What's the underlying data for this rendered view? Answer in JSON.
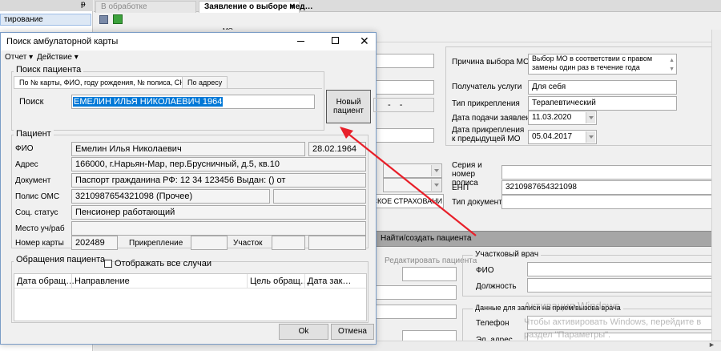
{
  "left_panel": {
    "pin": "ᵽ",
    "item": "тирование"
  },
  "doc_tabs": [
    {
      "label": "В обработке"
    },
    {
      "label": "Заявление о выборе мед…",
      "close": "✕"
    }
  ],
  "main_right": {
    "reason_label": "Причина выбора МО",
    "reason_value": "Выбор МО в соответствии с правом замены один раз в течение года",
    "recipient_label": "Получатель услуги",
    "recipient_value": "Для себя",
    "attach_type_label": "Тип прикрепления",
    "attach_type_value": "Терапевтический",
    "apply_date_label": "Дата подачи заявления",
    "apply_date_value": "11.03.2020",
    "prev_date_label": "Дата прикрепления к предыдущей МО",
    "prev_date_value": "05.04.2017",
    "series_label": "Серия и номер полиса",
    "enp_label": "ЕНП",
    "enp_value": "3210987654321098",
    "doc_type_label": "Тип документа",
    "insurer_value": "НСКОЕ СТРАХОВАНИ",
    "find_create_button": "Найти/создать пациента",
    "edit_patient_button": "Редактировать пациента",
    "doctor_group": "Участковый врач",
    "doctor_fio_label": "ФИО",
    "doctor_position_label": "Должность",
    "visit_group": "Данные для записи на прием/вызова врача",
    "phone_label": "Телефон",
    "email_label": "Эл. адрес",
    "watermark_title": "Активация Windows",
    "watermark_text": "Чтобы активировать Windows, перейдите в раздел \"Параметры\".",
    "mo_label": "МО"
  },
  "dialog": {
    "title": "Поиск амбулаторной карты",
    "menu": [
      {
        "label": "Отчет"
      },
      {
        "label": "Действие"
      }
    ],
    "search_group": "Поиск пациента",
    "search_tabs": [
      {
        "label": "По № карты, ФИО, году рождения, № полиса, СНИЛС"
      },
      {
        "label": "По адресу"
      }
    ],
    "search_label": "Поиск",
    "search_value": "ЕМЕЛИН ИЛЬЯ НИКОЛАЕВИЧ 1964",
    "new_patient_button": "Новый пациент",
    "patient_group": "Пациент",
    "fio_label": "ФИО",
    "fio_value": "Емелин Илья Николаевич",
    "birth_value": "28.02.1964",
    "address_label": "Адрес",
    "address_value": "166000, г.Нарьян-Мар, пер.Брусничный, д.5, кв.10",
    "document_label": "Документ",
    "document_value": "Паспорт гражданина РФ: 12 34 123456 Выдан: () от",
    "oms_label": "Полис ОМС",
    "oms_value": "3210987654321098 (Прочее)",
    "social_label": "Соц. статус",
    "social_value": "Пенсионер работающий",
    "workplace_label": "Место уч/раб",
    "card_label": "Номер карты",
    "card_value": "202489",
    "attachment_label": "Прикрепление",
    "district_label": "Участок",
    "appeals_group": "Обращения пациента",
    "show_all_label": "Отображать все случаи",
    "columns": [
      "Дата обращ…",
      "Направление",
      "Цель обращ…",
      "Дата зак…"
    ],
    "ok_button": "Ok",
    "cancel_button": "Отмена"
  },
  "colors": {
    "selection": "#0078d7",
    "arrow": "#e8202a",
    "accent_tab": "#ffffff"
  }
}
